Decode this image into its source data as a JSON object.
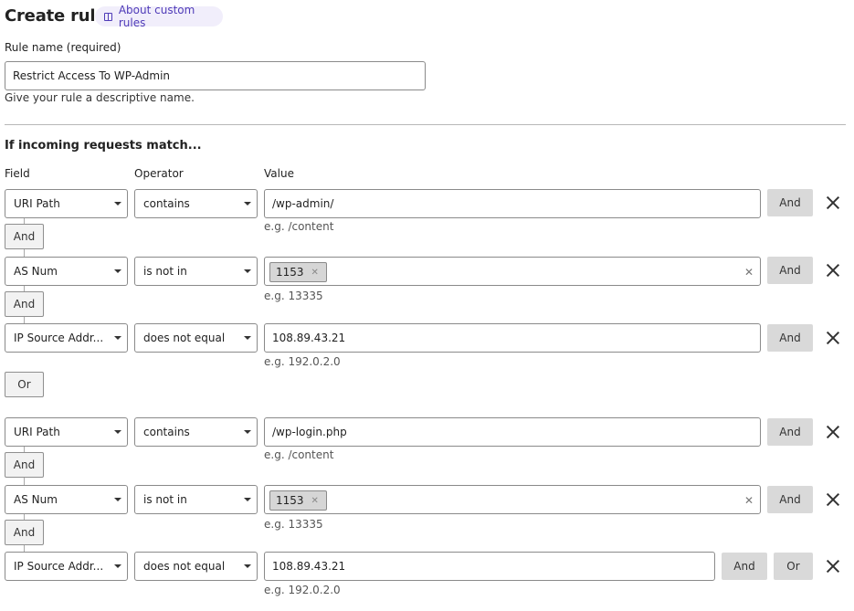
{
  "header": {
    "title": "Create rule",
    "about_link": "About custom rules"
  },
  "rule_name": {
    "label": "Rule name (required)",
    "value": "Restrict Access To WP-Admin",
    "help": "Give your rule a descriptive name."
  },
  "expression": {
    "section_title": "If incoming requests match...",
    "col_field": "Field",
    "col_operator": "Operator",
    "col_value": "Value",
    "and_label": "And",
    "or_label": "Or",
    "groups": [
      {
        "rows": [
          {
            "field": "URI Path",
            "operator": "contains",
            "value": "/wp-admin/",
            "hint": "e.g. /content"
          },
          {
            "field": "AS Num",
            "operator": "is not in",
            "tag": "1153",
            "hint": "e.g. 13335"
          },
          {
            "field": "IP Source Addr...",
            "operator": "does not equal",
            "value": "108.89.43.21",
            "hint": "e.g. 192.0.2.0"
          }
        ]
      },
      {
        "rows": [
          {
            "field": "URI Path",
            "operator": "contains",
            "value": "/wp-login.php",
            "hint": "e.g. /content"
          },
          {
            "field": "AS Num",
            "operator": "is not in",
            "tag": "1153",
            "hint": "e.g. 13335"
          },
          {
            "field": "IP Source Addr...",
            "operator": "does not equal",
            "value": "108.89.43.21",
            "hint": "e.g. 192.0.2.0"
          }
        ]
      }
    ]
  }
}
